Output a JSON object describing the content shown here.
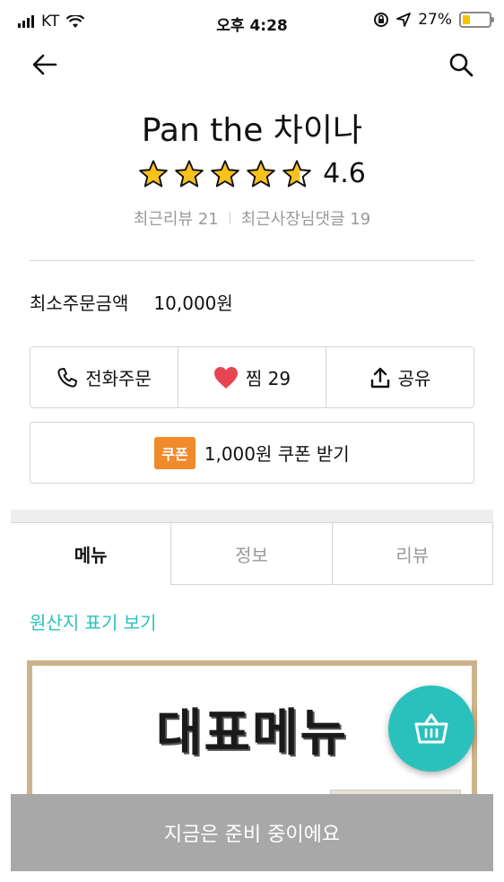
{
  "status_bar": {
    "carrier": "KT",
    "time": "오후 4:28",
    "battery": "27%",
    "battery_level": 0.27,
    "battery_color": "#f5c400"
  },
  "nav": {
    "back_icon": "arrow-left-icon",
    "search_icon": "search-icon"
  },
  "store": {
    "name": "Pan the 차이나",
    "rating": "4.6",
    "rating_value": 4.6,
    "recent_reviews": "최근리뷰 21",
    "owner_replies": "최근사장님댓글 19"
  },
  "min_order": {
    "label": "최소주문금액",
    "value": "10,000원"
  },
  "actions": {
    "phone": {
      "label": "전화주문",
      "icon": "phone-icon"
    },
    "like": {
      "label": "찜 29",
      "icon": "heart-icon",
      "color": "#e94452"
    },
    "share": {
      "label": "공유",
      "icon": "share-icon"
    }
  },
  "coupon": {
    "badge": "쿠폰",
    "label": "1,000원 쿠폰 받기",
    "badge_color": "#f08a2a"
  },
  "tabs": [
    {
      "label": "메뉴",
      "active": true
    },
    {
      "label": "정보",
      "active": false
    },
    {
      "label": "리뷰",
      "active": false
    }
  ],
  "origin_link": "원산지 표기 보기",
  "banner": {
    "title": "대표메뉴"
  },
  "fab": {
    "icon": "basket-icon",
    "color": "#2ac1bc"
  },
  "bottom_bar": {
    "label": "지금은 준비 중이에요"
  }
}
